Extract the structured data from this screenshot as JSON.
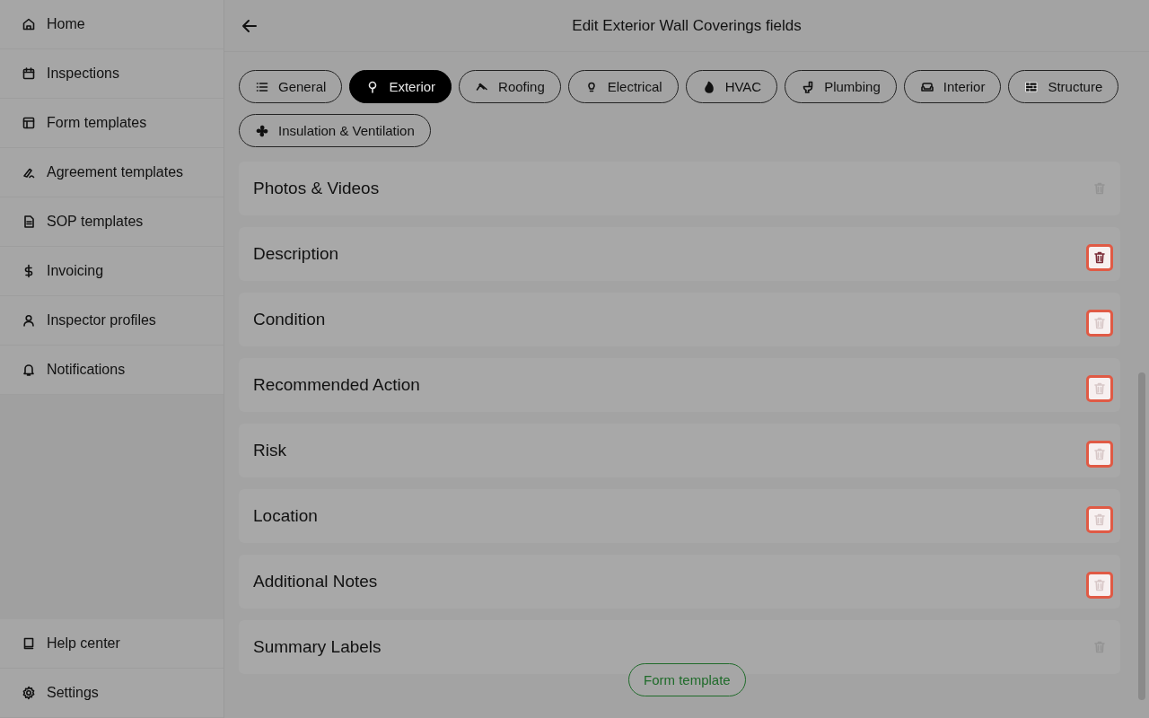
{
  "sidebar": {
    "items": [
      {
        "label": "Home"
      },
      {
        "label": "Inspections"
      },
      {
        "label": "Form templates"
      },
      {
        "label": "Agreement templates"
      },
      {
        "label": "SOP templates"
      },
      {
        "label": "Invoicing"
      },
      {
        "label": "Inspector profiles"
      },
      {
        "label": "Notifications"
      }
    ],
    "footer_items": [
      {
        "label": "Help center"
      },
      {
        "label": "Settings"
      }
    ]
  },
  "header": {
    "title": "Edit Exterior Wall Coverings fields"
  },
  "tabs": [
    {
      "label": "General",
      "selected": false
    },
    {
      "label": "Exterior",
      "selected": true
    },
    {
      "label": "Roofing",
      "selected": false
    },
    {
      "label": "Electrical",
      "selected": false
    },
    {
      "label": "HVAC",
      "selected": false
    },
    {
      "label": "Plumbing",
      "selected": false
    },
    {
      "label": "Interior",
      "selected": false
    },
    {
      "label": "Structure",
      "selected": false
    },
    {
      "label": "Insulation & Ventilation",
      "selected": false
    }
  ],
  "fields": [
    {
      "label": "Photos & Videos",
      "highlighted": false
    },
    {
      "label": "Description",
      "highlighted": true
    },
    {
      "label": "Condition",
      "highlighted": true
    },
    {
      "label": "Recommended Action",
      "highlighted": true
    },
    {
      "label": "Risk",
      "highlighted": true
    },
    {
      "label": "Location",
      "highlighted": true
    },
    {
      "label": "Additional Notes",
      "highlighted": true
    },
    {
      "label": "Summary Labels",
      "highlighted": false
    }
  ],
  "floating_button": {
    "label": "Form template"
  }
}
